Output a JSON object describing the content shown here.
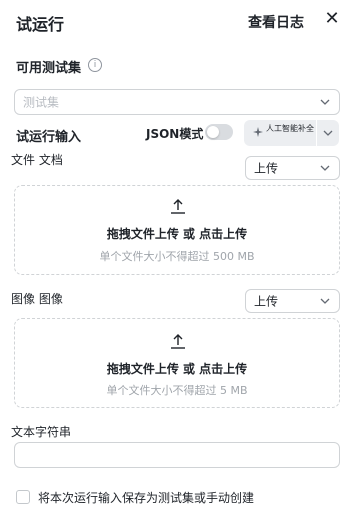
{
  "header": {
    "title": "试运行",
    "log_link": "查看日志",
    "close_symbol": "✕"
  },
  "dataset": {
    "label": "可用测试集",
    "info_icon": "info-icon",
    "placeholder": "测试集"
  },
  "run_input": {
    "label": "试运行输入",
    "json_mode_label": "JSON模式",
    "json_mode_enabled": false,
    "ai_button_label": "人工智能补全"
  },
  "file_field": {
    "label": "文件 文档",
    "mode": "上传",
    "upload_title": "拖拽文件上传 或 点击上传",
    "upload_hint": "单个文件大小不得超过 500 MB"
  },
  "image_field": {
    "label": "图像 图像",
    "mode": "上传",
    "upload_title": "拖拽文件上传 或 点击上传",
    "upload_hint": "单个文件大小不得超过 5 MB"
  },
  "text_field": {
    "label": "文本字符串",
    "value": ""
  },
  "save_option": {
    "label": "将本次运行输入保存为测试集或手动创建",
    "checked": false
  },
  "colors": {
    "text": "#1f2329",
    "muted": "#a0a5ab",
    "border": "#d0d3d6",
    "toggle_off": "#d9dce0"
  }
}
